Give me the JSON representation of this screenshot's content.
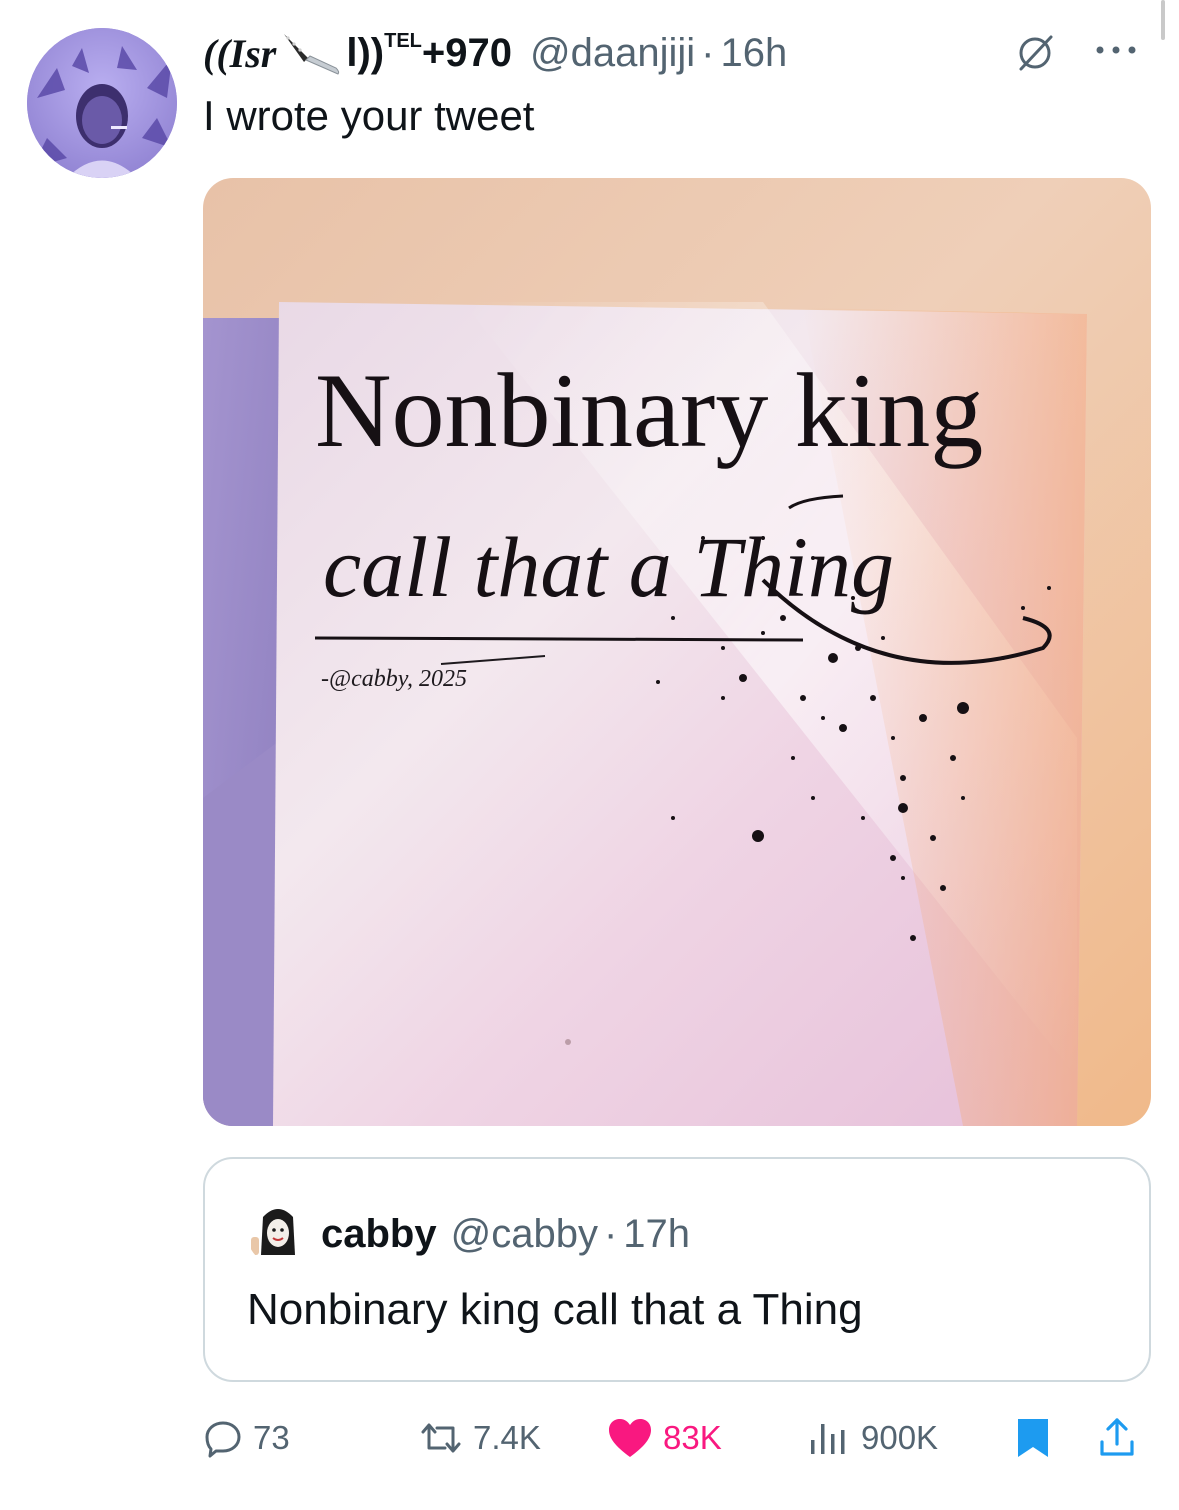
{
  "author": {
    "display_name_prefix": "((Isr",
    "display_name_mid": "l))",
    "display_name_tel": "TEL",
    "display_name_suffix": "+970",
    "handle": "@daanjiji",
    "separator": "·",
    "time": "16h"
  },
  "tweet": {
    "text": "I wrote your tweet"
  },
  "media": {
    "line1": "Nonbinary king",
    "line2": "call that a Thing",
    "signature": "-@cabby, 2025"
  },
  "quote": {
    "display_name": "cabby",
    "handle": "@cabby",
    "separator": "·",
    "time": "17h",
    "text": "Nonbinary king call that a Thing"
  },
  "actions": {
    "replies": "73",
    "reposts": "7.4K",
    "likes": "83K",
    "views": "900K"
  },
  "icons": {
    "verify": "null-set-icon",
    "more": "more-dots-icon",
    "reply": "reply-bubble-icon",
    "repost": "repost-arrows-icon",
    "like": "heart-filled-icon",
    "views": "views-bars-icon",
    "bookmark": "bookmark-filled-icon",
    "share": "share-upload-icon"
  },
  "colors": {
    "text_primary": "#0f1419",
    "text_secondary": "#536471",
    "like": "#f91880",
    "bookmark": "#1d9bf0",
    "border": "#cfd9de"
  }
}
